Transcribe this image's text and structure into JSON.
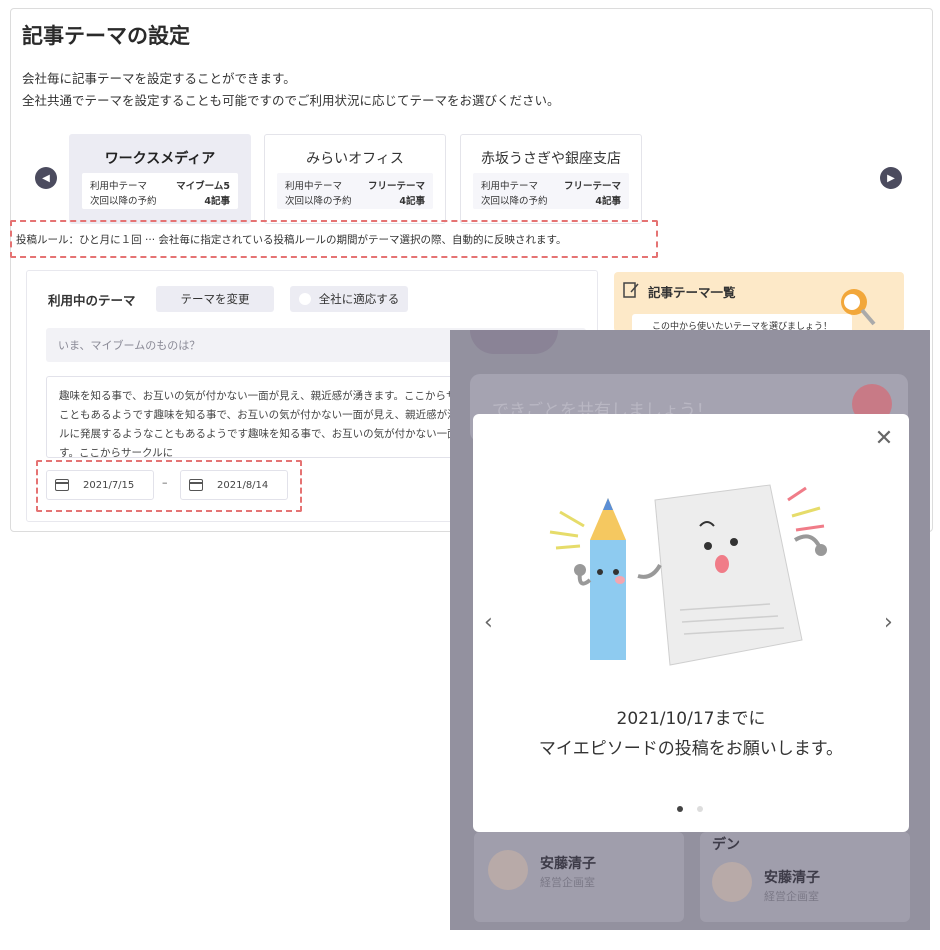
{
  "settings": {
    "title": "記事テーマの設定",
    "description_1": "会社毎に記事テーマを設定することができます。",
    "description_2": "全社共通でテーマを設定することも可能ですのでご利用状況に応じてテーマをお選びください。",
    "companies": [
      {
        "name": "ワークスメディア",
        "current_label": "利用中テーマ",
        "current_value": "マイブーム5",
        "next_label": "次回以降の予約",
        "next_value": "4記事",
        "active": true
      },
      {
        "name": "みらいオフィス",
        "current_label": "利用中テーマ",
        "current_value": "フリーテーマ",
        "next_label": "次回以降の予約",
        "next_value": "4記事",
        "active": false
      },
      {
        "name": "赤坂うさぎや銀座支店",
        "current_label": "利用中テーマ",
        "current_value": "フリーテーマ",
        "next_label": "次回以降の予約",
        "next_value": "4記事",
        "active": false
      }
    ],
    "rule_text": "投稿ルール：ひと月に１回 ··· 会社毎に指定されている投稿ルールの期間がテーマ選択の際、自動的に反映されます。",
    "form": {
      "theme_label": "利用中のテーマ",
      "change_button": "テーマを変更",
      "apply_all_label": "全社に適応する",
      "title_placeholder": "いま、マイブームのものは？",
      "body_text": "趣味を知る事で、お互いの気が付かない一面が見え、親近感が湧きます。ここからサークルに発展するようなこともあるようです趣味を知る事で、お互いの気が付かない一面が見え、親近感が湧きます。ここからサークルに発展するようなこともあるようです趣味を知る事で、お互いの気が付かない一面が見え、親近感が湧きます。ここからサークルに",
      "date_from": "2021/7/15",
      "date_separator": "–",
      "date_to": "2021/8/14"
    },
    "theme_list": {
      "title": "記事テーマ一覧",
      "subtitle": "この中から使いたいテーマを選びましょう！"
    }
  },
  "background_app": {
    "share_prompt": "できごとを共有しましょう！",
    "users": [
      {
        "name": "安藤清子",
        "role": "経営企画室"
      },
      {
        "name": "安藤清子",
        "role": "経営企画室"
      }
    ],
    "partial_text": "デン"
  },
  "modal": {
    "message_line_1": "2021/10/17までに",
    "message_line_2": "マイエピソードの投稿をお願いします。",
    "current_page": 1,
    "page_count": 2
  },
  "colors": {
    "accent_dashed": "#e57373",
    "overlay": "#93919f",
    "active_card": "#ececf3",
    "theme_list_bg": "#fde9c8",
    "pencil_blue": "#8ecbf0",
    "pencil_tip": "#f5c860"
  },
  "icons": {
    "prev": "chevron-left-icon",
    "next": "chevron-right-icon",
    "close": "close-icon",
    "calendar": "calendar-icon",
    "edit": "edit-icon",
    "lamp": "lamp-icon"
  }
}
